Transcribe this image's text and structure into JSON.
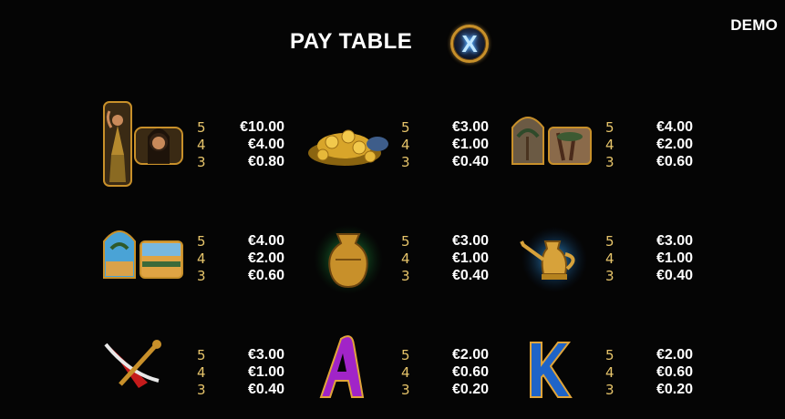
{
  "badge": {
    "demo": "DEMO"
  },
  "header": {
    "title": "PAY TABLE",
    "close_glyph": "X"
  },
  "symbols": [
    {
      "icon": "dancer-portrait-icon",
      "pays": [
        {
          "n": "5",
          "v": "€10.00"
        },
        {
          "n": "4",
          "v": "€4.00"
        },
        {
          "n": "3",
          "v": "€0.80"
        }
      ]
    },
    {
      "icon": "gold-coins-icon",
      "pays": [
        {
          "n": "5",
          "v": "€3.00"
        },
        {
          "n": "4",
          "v": "€1.00"
        },
        {
          "n": "3",
          "v": "€0.40"
        }
      ]
    },
    {
      "icon": "palm-arches-icon",
      "pays": [
        {
          "n": "5",
          "v": "€4.00"
        },
        {
          "n": "4",
          "v": "€2.00"
        },
        {
          "n": "3",
          "v": "€0.60"
        }
      ]
    },
    {
      "icon": "oasis-scene-icon",
      "pays": [
        {
          "n": "5",
          "v": "€4.00"
        },
        {
          "n": "4",
          "v": "€2.00"
        },
        {
          "n": "3",
          "v": "€0.60"
        }
      ]
    },
    {
      "icon": "golden-vase-icon",
      "pays": [
        {
          "n": "5",
          "v": "€3.00"
        },
        {
          "n": "4",
          "v": "€1.00"
        },
        {
          "n": "3",
          "v": "€0.40"
        }
      ]
    },
    {
      "icon": "golden-teapot-icon",
      "pays": [
        {
          "n": "5",
          "v": "€3.00"
        },
        {
          "n": "4",
          "v": "€1.00"
        },
        {
          "n": "3",
          "v": "€0.40"
        }
      ]
    },
    {
      "icon": "crossed-swords-icon",
      "pays": [
        {
          "n": "5",
          "v": "€3.00"
        },
        {
          "n": "4",
          "v": "€1.00"
        },
        {
          "n": "3",
          "v": "€0.40"
        }
      ]
    },
    {
      "icon": "letter-a-icon",
      "pays": [
        {
          "n": "5",
          "v": "€2.00"
        },
        {
          "n": "4",
          "v": "€0.60"
        },
        {
          "n": "3",
          "v": "€0.20"
        }
      ]
    },
    {
      "icon": "letter-k-icon",
      "pays": [
        {
          "n": "5",
          "v": "€2.00"
        },
        {
          "n": "4",
          "v": "€0.60"
        },
        {
          "n": "3",
          "v": "€0.20"
        }
      ]
    }
  ],
  "colors": {
    "background": "#050505",
    "count_gold": "#e6c46a",
    "frame_gold": "#c8902a"
  }
}
